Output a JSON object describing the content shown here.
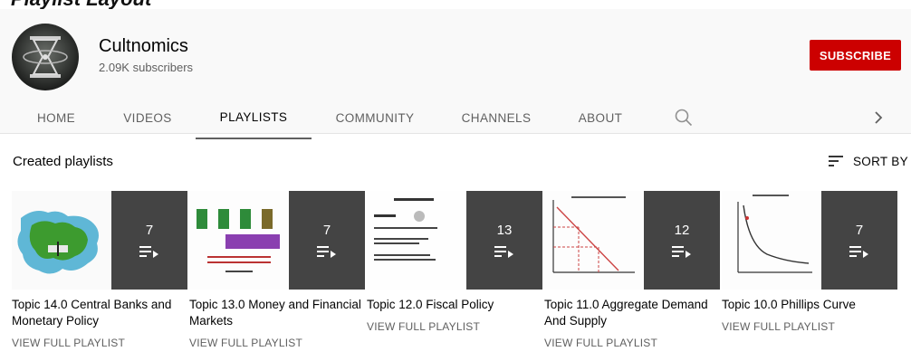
{
  "top_banner": {
    "text": "Playlist Layout"
  },
  "channel": {
    "name": "Cultnomics",
    "subscribers": "2.09K subscribers",
    "subscribe_label": "SUBSCRIBE"
  },
  "tabs": [
    {
      "label": "HOME"
    },
    {
      "label": "VIDEOS"
    },
    {
      "label": "PLAYLISTS"
    },
    {
      "label": "COMMUNITY"
    },
    {
      "label": "CHANNELS"
    },
    {
      "label": "ABOUT"
    }
  ],
  "active_tab": "PLAYLISTS",
  "section": {
    "title": "Created playlists",
    "sort_label": "SORT BY"
  },
  "playlists": [
    {
      "title": "Topic 14.0 Central Banks and Monetary Policy",
      "count": "7",
      "action": "VIEW FULL PLAYLIST"
    },
    {
      "title": "Topic 13.0 Money and Financial Markets",
      "count": "7",
      "action": "VIEW FULL PLAYLIST"
    },
    {
      "title": "Topic 12.0 Fiscal Policy",
      "count": "13",
      "action": "VIEW FULL PLAYLIST"
    },
    {
      "title": "Topic 11.0 Aggregate Demand And Supply",
      "count": "12",
      "action": "VIEW FULL PLAYLIST"
    },
    {
      "title": "Topic 10.0 Phillips Curve",
      "count": "7",
      "action": "VIEW FULL PLAYLIST"
    }
  ],
  "colors": {
    "subscribe_red": "#cc0000",
    "header_bg": "#f9f9f9",
    "muted_text": "#606060"
  },
  "icons": {
    "search": "search-icon",
    "next": "chevron-right-icon",
    "sort": "sort-icon",
    "playlist": "playlist-play-icon"
  }
}
